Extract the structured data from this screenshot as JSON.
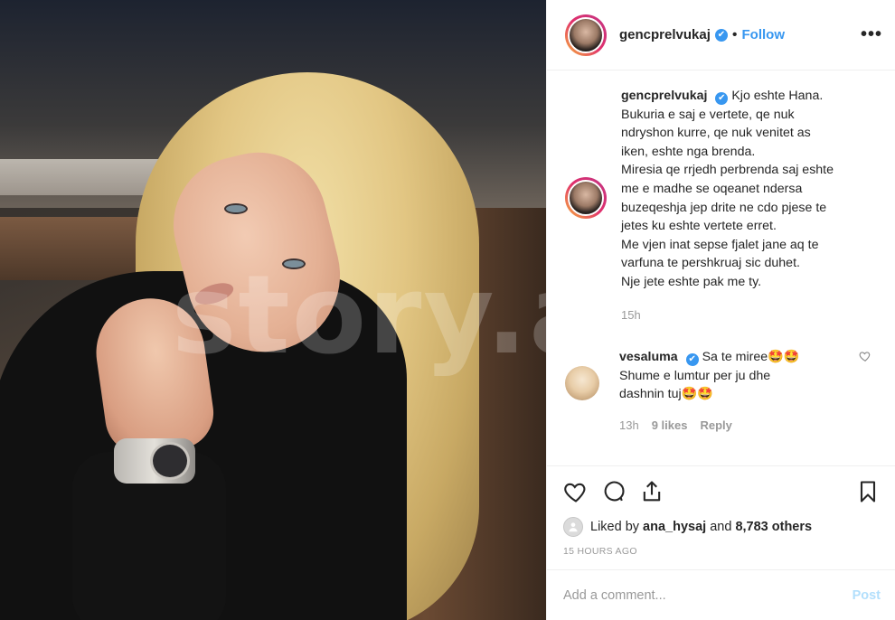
{
  "header": {
    "username": "gencprelvukaj",
    "verified_icon": "✔",
    "separator": "•",
    "follow_label": "Follow",
    "more_label": "•••"
  },
  "caption": {
    "username": "gencprelvukaj",
    "lines": [
      "Kjo eshte Hana.",
      "Bukuria e saj e vertete, qe nuk",
      "ndryshon kurre, qe nuk venitet as",
      "iken, eshte nga brenda.",
      "Miresia qe rrjedh perbrenda saj eshte",
      "me e madhe se oqeanet ndersa",
      "buzeqeshja jep drite ne cdo pjese te",
      "jetes ku eshte vertete erret.",
      "Me vjen inat sepse fjalet jane aq te",
      "varfuna te pershkruaj sic duhet.",
      "Nje jete eshte pak me ty."
    ],
    "time": "15h"
  },
  "comment": {
    "username": "vesaluma",
    "line1": "Sa te miree🤩🤩",
    "line2": "Shume e lumtur per ju dhe",
    "line3": "dashnin tuj🤩🤩",
    "time": "13h",
    "likes": "9 likes",
    "reply": "Reply"
  },
  "photo": {
    "watermark": "story.al"
  },
  "likes": {
    "prefix": "Liked by",
    "user": "ana_hysaj",
    "middle": "and",
    "count": "8,783 others"
  },
  "timestamp": "15 HOURS AGO",
  "add_comment": {
    "placeholder": "Add a comment...",
    "post_label": "Post"
  },
  "colors": {
    "accent": "#3897f0",
    "post_disabled": "#b2dffc",
    "muted": "#999999"
  }
}
